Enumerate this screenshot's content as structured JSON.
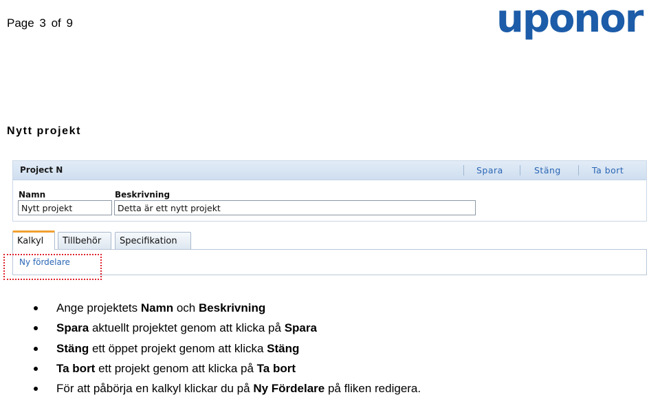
{
  "header": {
    "page_label": "Page 3 of 9",
    "logo_text": "uponor",
    "brand_color": "#1c5ca8"
  },
  "section_title": "Nytt projekt",
  "panel": {
    "title": "Project N",
    "actions": [
      "Spara",
      "Stäng",
      "Ta bort"
    ],
    "name_label": "Namn",
    "name_value": "Nytt projekt",
    "desc_label": "Beskrivning",
    "desc_value": "Detta är ett nytt projekt"
  },
  "tabs": [
    "Kalkyl",
    "Tillbehör",
    "Specifikation"
  ],
  "tab_action": "Ny fördelare",
  "bullets": [
    [
      {
        "t": "Ange projektets ",
        "b": false
      },
      {
        "t": "Namn",
        "b": true
      },
      {
        "t": " och ",
        "b": false
      },
      {
        "t": "Beskrivning",
        "b": true
      }
    ],
    [
      {
        "t": "Spara",
        "b": true
      },
      {
        "t": " aktuellt projektet genom att klicka på ",
        "b": false
      },
      {
        "t": "Spara",
        "b": true
      }
    ],
    [
      {
        "t": "Stäng",
        "b": true
      },
      {
        "t": " ett öppet projekt genom att klicka ",
        "b": false
      },
      {
        "t": "Stäng",
        "b": true
      }
    ],
    [
      {
        "t": "Ta bort",
        "b": true
      },
      {
        "t": " ett projekt genom att klicka på ",
        "b": false
      },
      {
        "t": "Ta bort",
        "b": true
      }
    ],
    [
      {
        "t": "För att påbörja en kalkyl klickar du på ",
        "b": false
      },
      {
        "t": "Ny Fördelare",
        "b": true
      },
      {
        "t": " på fliken redigera.",
        "b": false
      }
    ]
  ]
}
